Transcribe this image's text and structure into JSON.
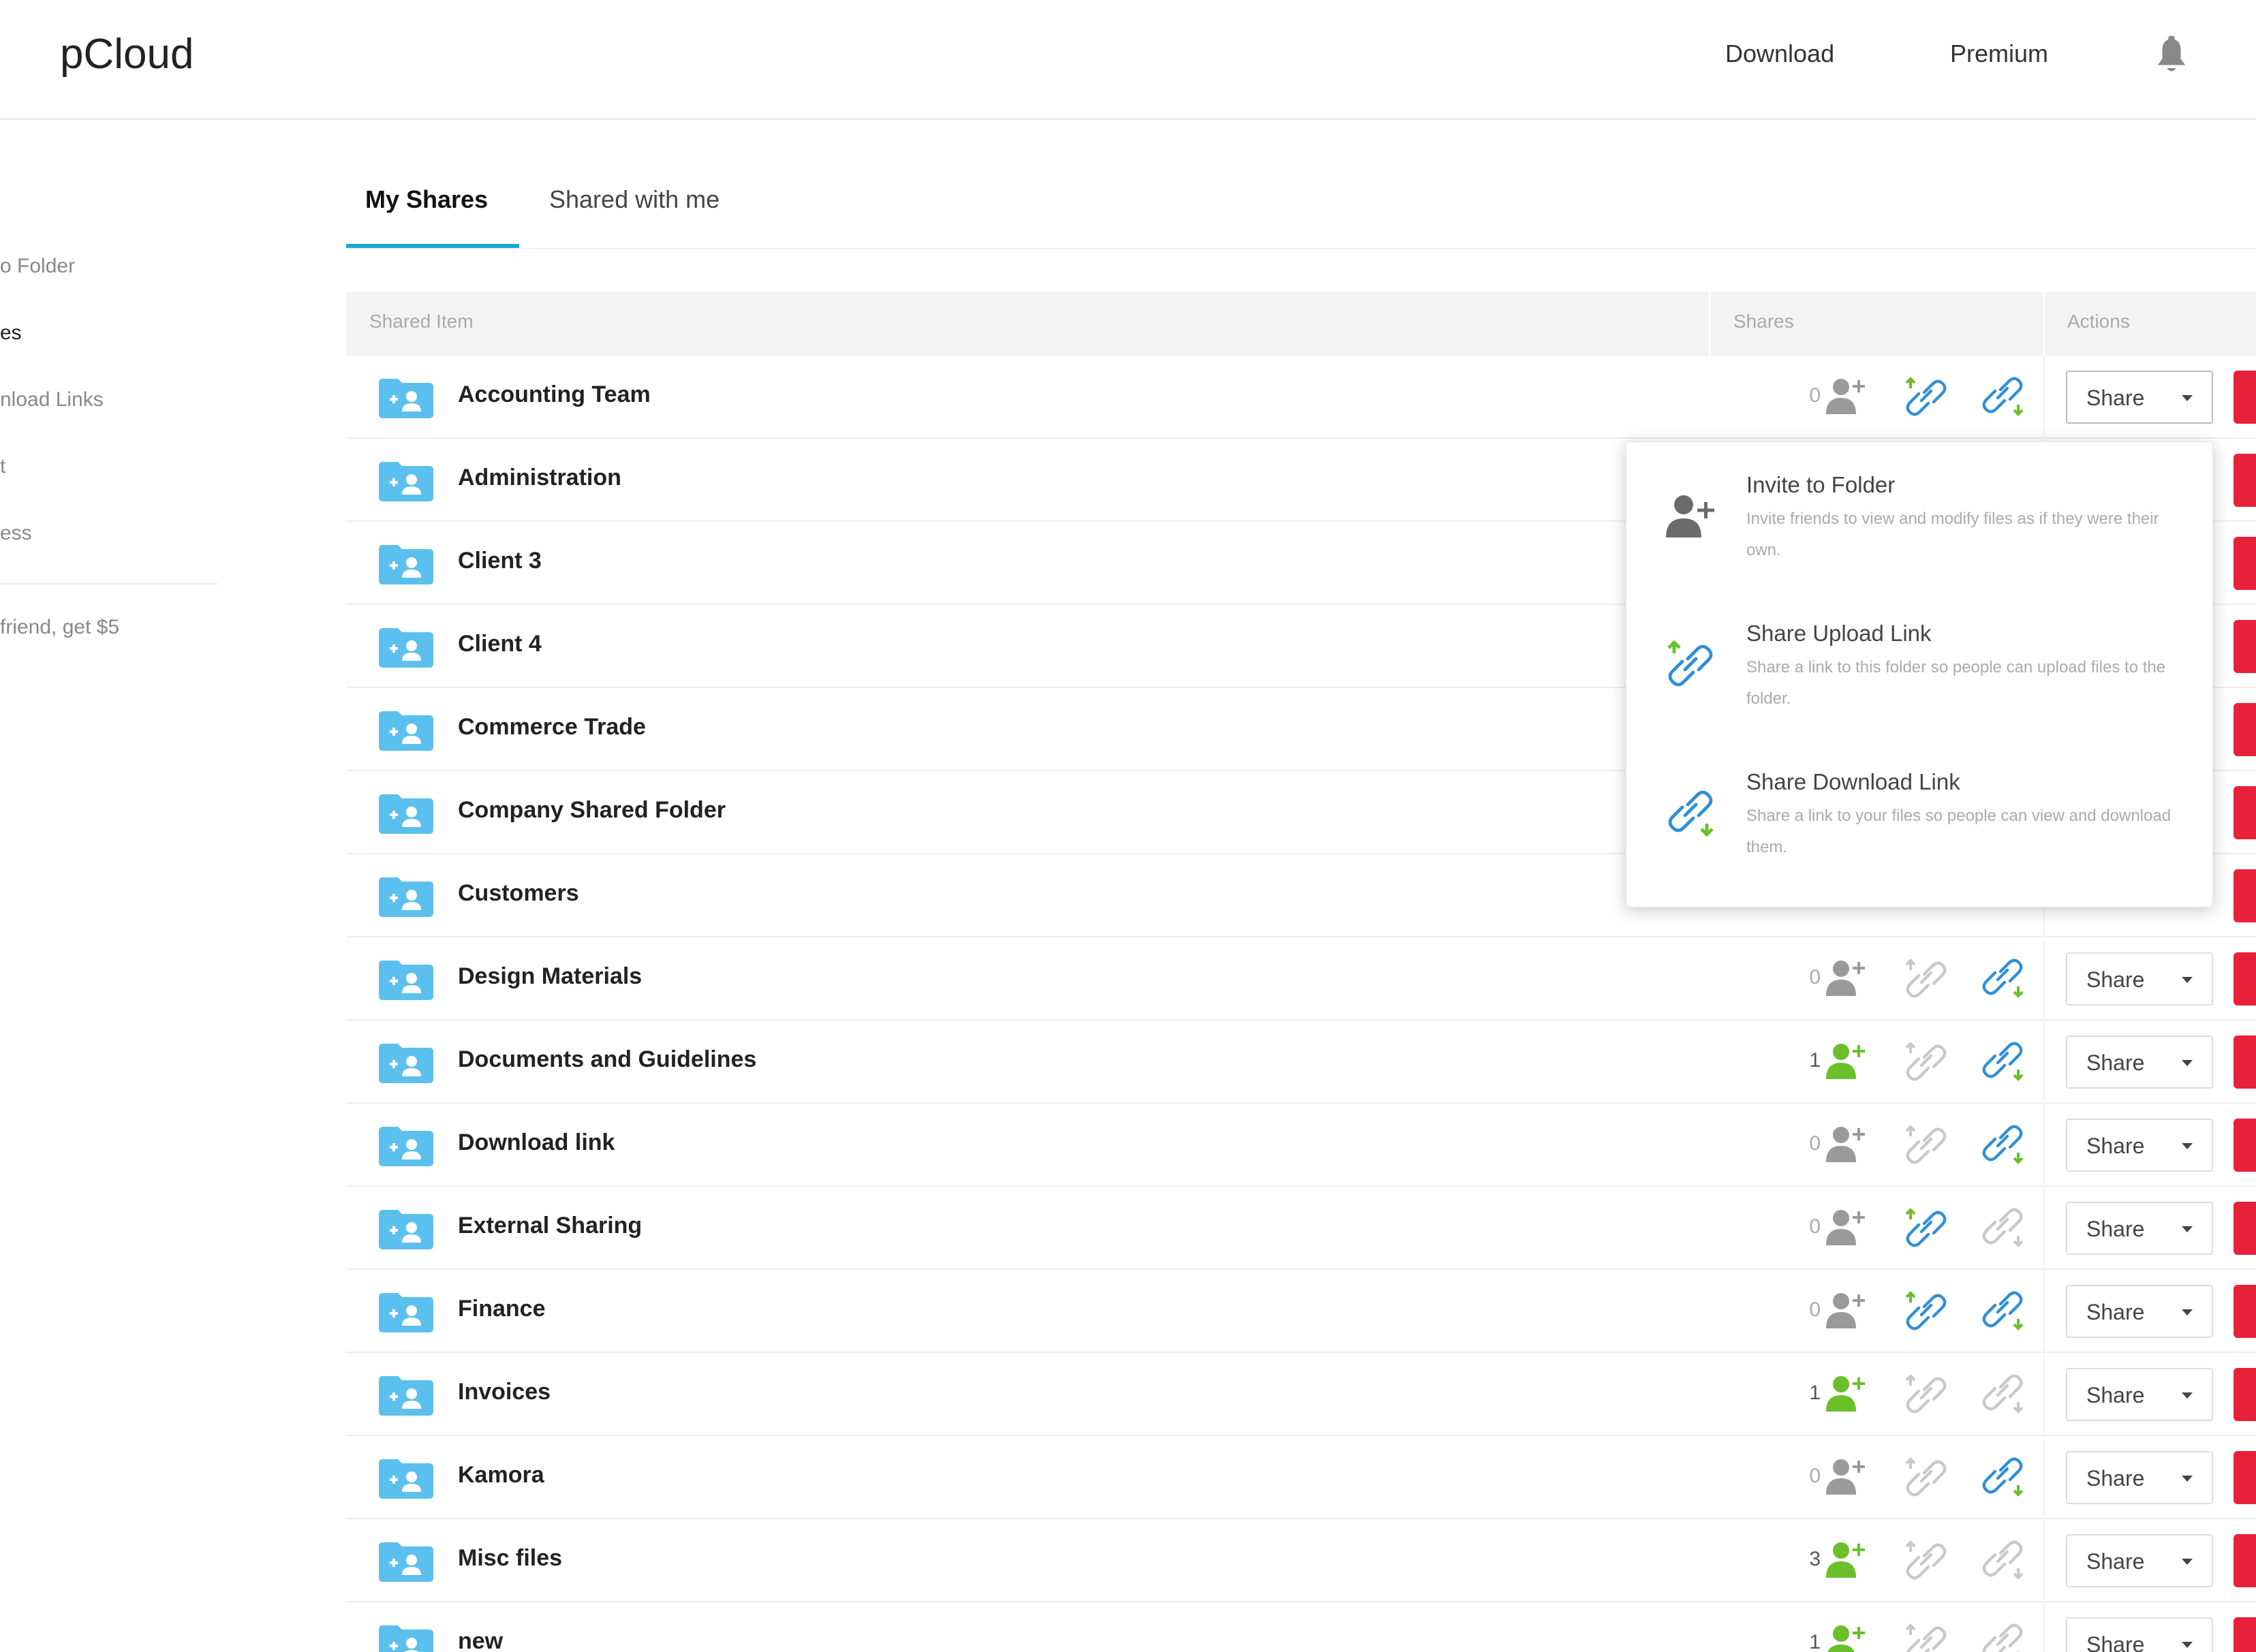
{
  "app": {
    "logo": "pCloud"
  },
  "header": {
    "download_label": "Download",
    "premium_label": "Premium"
  },
  "sidebar": {
    "items": [
      {
        "label": "o Folder"
      },
      {
        "label": "es"
      },
      {
        "label": "nload Links"
      },
      {
        "label": "t"
      },
      {
        "label": "ess"
      },
      {
        "label": "friend, get $5"
      }
    ]
  },
  "tabs": [
    {
      "label": "My Shares"
    },
    {
      "label": "Shared with me"
    }
  ],
  "table": {
    "headers": {
      "item": "Shared Item",
      "shares": "Shares",
      "actions": "Actions"
    },
    "share_button_label": "Share",
    "rows": [
      {
        "name": "Accounting Team",
        "count": "0"
      },
      {
        "name": "Administration",
        "count": ""
      },
      {
        "name": "Client 3",
        "count": ""
      },
      {
        "name": "Client 4",
        "count": ""
      },
      {
        "name": "Commerce Trade",
        "count": ""
      },
      {
        "name": "Company Shared Folder",
        "count": ""
      },
      {
        "name": "Customers",
        "count": ""
      },
      {
        "name": "Design Materials",
        "count": "0"
      },
      {
        "name": "Documents and Guidelines",
        "count": "1"
      },
      {
        "name": "Download link",
        "count": "0"
      },
      {
        "name": "External Sharing",
        "count": "0"
      },
      {
        "name": "Finance",
        "count": "0"
      },
      {
        "name": "Invoices",
        "count": "1"
      },
      {
        "name": "Kamora",
        "count": "0"
      },
      {
        "name": "Misc files",
        "count": "3"
      },
      {
        "name": "new",
        "count": "1"
      }
    ]
  },
  "dropdown": {
    "items": [
      {
        "title": "Invite to Folder",
        "desc": "Invite friends to view and modify files as if they were their own."
      },
      {
        "title": "Share Upload Link",
        "desc": "Share a link to this folder so people can upload files to the folder."
      },
      {
        "title": "Share Download Link",
        "desc": "Share a link to your files so people can view and download them."
      }
    ]
  },
  "colors": {
    "accent": "#17a9d6",
    "danger": "#e8213a",
    "shared_user": "#6abf2a",
    "link_active": "#2f8fd8",
    "icon_inactive": "#c8c8c8"
  }
}
